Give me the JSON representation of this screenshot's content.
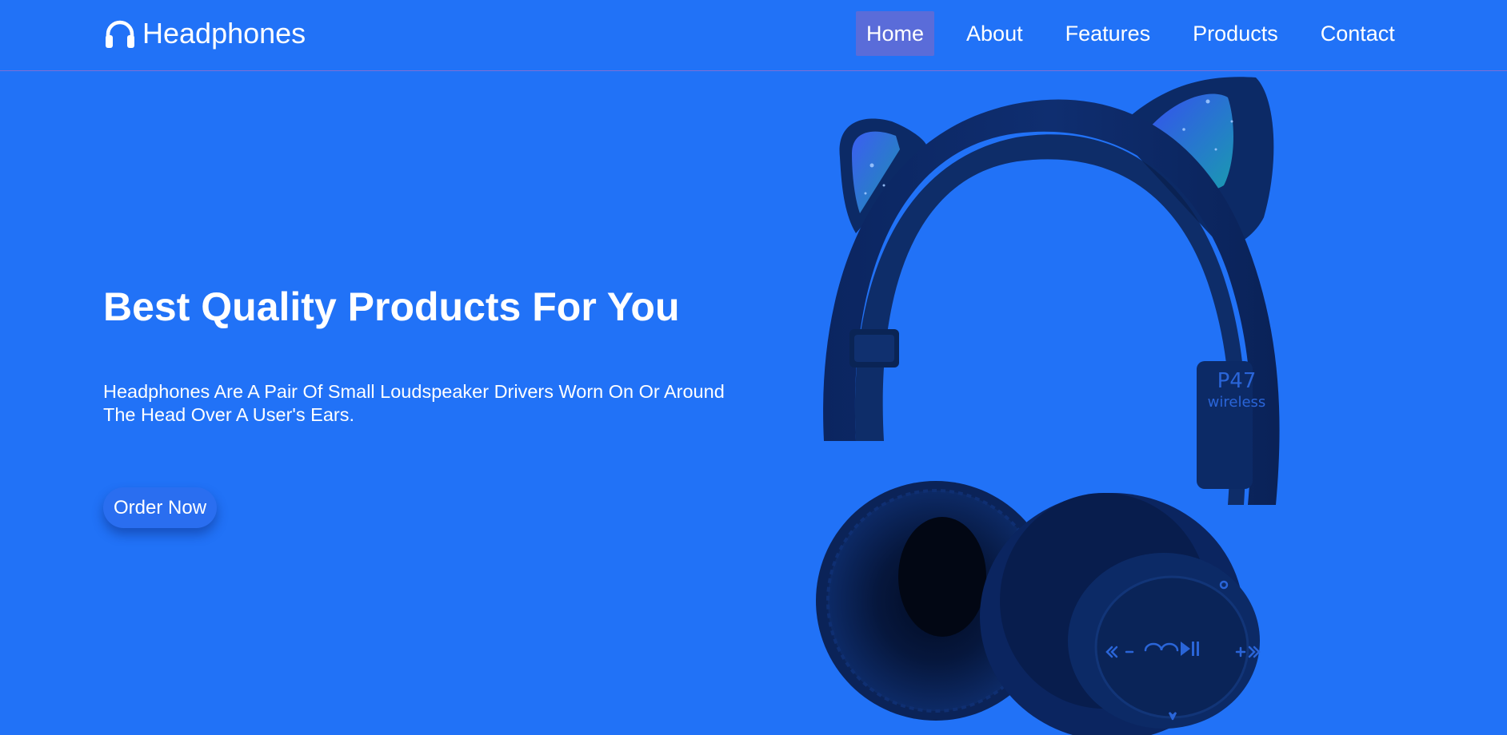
{
  "header": {
    "brand": {
      "name": "Headphones",
      "icon": "headphones-icon"
    },
    "nav": [
      {
        "label": "Home",
        "active": true
      },
      {
        "label": "About",
        "active": false
      },
      {
        "label": "Features",
        "active": false
      },
      {
        "label": "Products",
        "active": false
      },
      {
        "label": "Contact",
        "active": false
      }
    ]
  },
  "hero": {
    "title": "Best Quality Products For You",
    "description": "Headphones Are A Pair Of Small Loudspeaker Drivers Worn On Or Around The Head Over A User's Ears.",
    "cta_label": "Order Now"
  },
  "product": {
    "model_text": "P47",
    "model_subtext": "wireless"
  },
  "colors": {
    "background": "#2172f7",
    "active_nav": "#5a6cd9",
    "header_border": "#7c6fd6",
    "product_dark": "#0c2a66",
    "ear_glow": "#2d63e8"
  }
}
